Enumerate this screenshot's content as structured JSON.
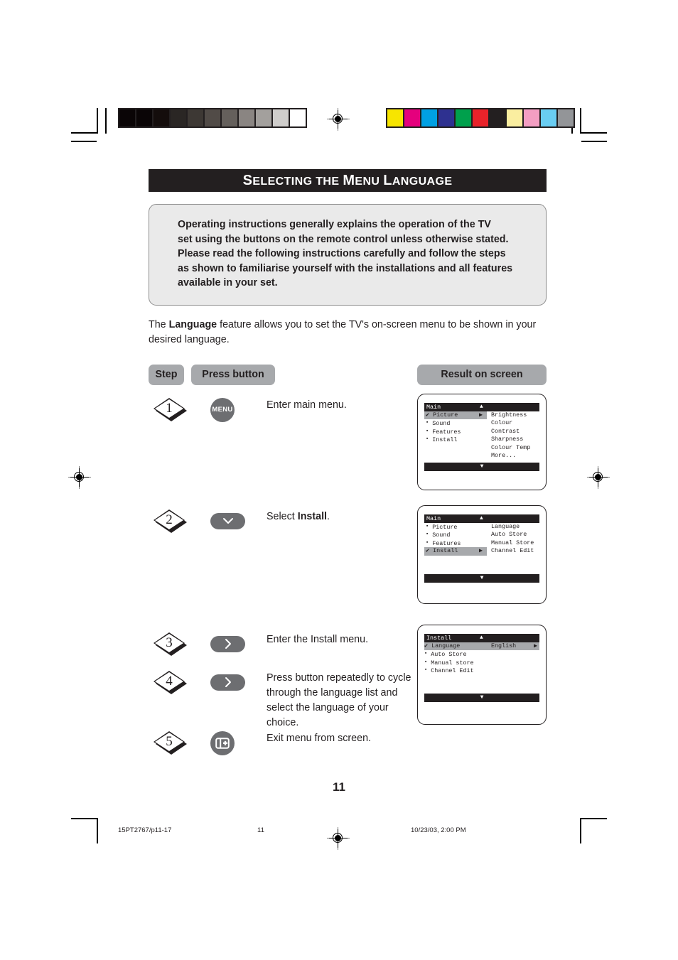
{
  "document": {
    "title": "Selecting the Menu Language",
    "title_parts": [
      {
        "big": "S",
        "small": "ELECTING"
      },
      {
        "big": "",
        "small": "THE"
      },
      {
        "big": "M",
        "small": "ENU"
      },
      {
        "big": "L",
        "small": "ANGUAGE"
      }
    ],
    "page_number": "11"
  },
  "note_box": {
    "lines": [
      "Operating instructions generally explains the operation of the TV",
      "set using the buttons on the remote control unless otherwise stated.",
      "Please read the following instructions carefully and follow the steps",
      "as shown to familiarise yourself with the installations and all features",
      "available in your set."
    ]
  },
  "intro": {
    "prefix": "The ",
    "bold": "Language",
    "suffix": " feature allows you to set the TV's on-screen menu to be shown in your desired language."
  },
  "table_headers": {
    "step": "Step",
    "press_button": "Press button",
    "result": "Result on screen"
  },
  "steps": [
    {
      "number": "1",
      "button": {
        "type": "round",
        "label": "MENU",
        "icon": "menu-button"
      },
      "text": "Enter main menu.",
      "text_bold": "",
      "text_suffix": ""
    },
    {
      "number": "2",
      "button": {
        "type": "pill",
        "label": "",
        "icon": "chevron-down-icon"
      },
      "text": "Select ",
      "text_bold": "Install",
      "text_suffix": "."
    },
    {
      "number": "3",
      "button": {
        "type": "pill",
        "label": "",
        "icon": "chevron-right-icon"
      },
      "text": "Enter the Install menu.",
      "text_bold": "",
      "text_suffix": ""
    },
    {
      "number": "4",
      "button": {
        "type": "pill",
        "label": "",
        "icon": "chevron-right-icon"
      },
      "text": "Press button repeatedly to cycle through the language list and select the language of your choice.",
      "text_bold": "",
      "text_suffix": ""
    },
    {
      "number": "5",
      "button": {
        "type": "round",
        "label": "",
        "icon": "exit-menu-icon"
      },
      "text": "Exit menu from screen.",
      "text_bold": "",
      "text_suffix": ""
    }
  ],
  "screens": [
    {
      "id": "main-picture",
      "header": "Main",
      "up_arrow": "▲",
      "down_arrow": "▼",
      "rows": [
        {
          "marker": "check",
          "label": "Picture",
          "selected": true,
          "arrow": true,
          "right": "Brightness"
        },
        {
          "marker": "square",
          "label": "Sound",
          "selected": false,
          "arrow": false,
          "right": "Colour"
        },
        {
          "marker": "square",
          "label": "Features",
          "selected": false,
          "arrow": false,
          "right": "Contrast"
        },
        {
          "marker": "square",
          "label": "Install",
          "selected": false,
          "arrow": false,
          "right": "Sharpness"
        },
        {
          "marker": "none",
          "label": "",
          "selected": false,
          "arrow": false,
          "right": "Colour Temp"
        },
        {
          "marker": "none",
          "label": "",
          "selected": false,
          "arrow": false,
          "right": "More..."
        }
      ]
    },
    {
      "id": "main-install",
      "header": "Main",
      "up_arrow": "▲",
      "down_arrow": "▼",
      "rows": [
        {
          "marker": "square",
          "label": "Picture",
          "selected": false,
          "arrow": false,
          "right": "Language"
        },
        {
          "marker": "square",
          "label": "Sound",
          "selected": false,
          "arrow": false,
          "right": "Auto Store"
        },
        {
          "marker": "square",
          "label": "Features",
          "selected": false,
          "arrow": false,
          "right": "Manual Store"
        },
        {
          "marker": "check",
          "label": "Install",
          "selected": true,
          "arrow": true,
          "right": "Channel Edit"
        }
      ]
    },
    {
      "id": "install-menu",
      "header": "Install",
      "up_arrow": "▲",
      "down_arrow": "▼",
      "rows": [
        {
          "marker": "check",
          "label": "Language",
          "selected": true,
          "arrow": true,
          "right": "English"
        },
        {
          "marker": "square",
          "label": "Auto Store",
          "selected": false,
          "arrow": false,
          "right": ""
        },
        {
          "marker": "square",
          "label": "Manual store",
          "selected": false,
          "arrow": false,
          "right": ""
        },
        {
          "marker": "square",
          "label": "Channel Edit",
          "selected": false,
          "arrow": false,
          "right": ""
        }
      ]
    }
  ],
  "footer": {
    "left": "15PT2767/p11-17",
    "center": "11",
    "right": "10/23/03, 2:00 PM"
  },
  "calibration": {
    "grayscale": [
      "#0a0506",
      "#0a0506",
      "#140d0c",
      "#2a2624",
      "#3d3834",
      "#514b47",
      "#65605c",
      "#8a8582",
      "#a3a09d",
      "#cfcdcb",
      "#ffffff"
    ],
    "colors": [
      "#f7e500",
      "#e5007d",
      "#00a0e3",
      "#2e3190",
      "#00a04c",
      "#e8232a",
      "#231f20",
      "#faeea0",
      "#f39ec2",
      "#69cdf2",
      "#939598"
    ]
  }
}
